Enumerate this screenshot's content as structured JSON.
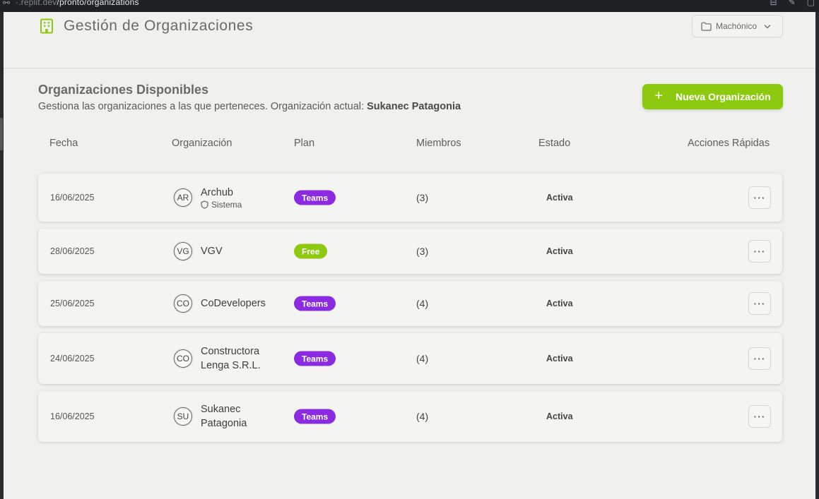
{
  "browser": {
    "url_prefix": "·.replit.dev",
    "url_path": "/pronto/organizations"
  },
  "header": {
    "title": "Gestión de Organizaciones",
    "icon": "building-icon",
    "project_select": "Machónico"
  },
  "section": {
    "title": "Organizaciones Disponibles",
    "subtitle": "Gestiona las organizaciones a las que perteneces. Organización actual: ",
    "current_org": "Sukanec Patagonia",
    "new_button": "Nueva Organización"
  },
  "table": {
    "headers": [
      "Fecha",
      "Organización",
      "Plan",
      "Miembros",
      "Estado",
      "Acciones Rápidas"
    ],
    "rows": [
      {
        "date": "16/06/2025",
        "initials": "AR",
        "name": "Archub",
        "name2": "",
        "tag": "Sistema",
        "plan": "Teams",
        "members": "(3)",
        "status": "Activa"
      },
      {
        "date": "28/06/2025",
        "initials": "VG",
        "name": "VGV",
        "name2": "",
        "tag": "",
        "plan": "Free",
        "members": "(3)",
        "status": "Activa"
      },
      {
        "date": "25/06/2025",
        "initials": "CO",
        "name": "CoDevelopers",
        "name2": "",
        "tag": "",
        "plan": "Teams",
        "members": "(4)",
        "status": "Activa"
      },
      {
        "date": "24/06/2025",
        "initials": "CO",
        "name": "Constructora",
        "name2": "Lenga S.R.L.",
        "tag": "",
        "plan": "Teams",
        "members": "(4)",
        "status": "Activa"
      },
      {
        "date": "16/06/2025",
        "initials": "SU",
        "name": "Sukanec",
        "name2": "Patagonia",
        "tag": "",
        "plan": "Teams",
        "members": "(4)",
        "status": "Activa"
      }
    ],
    "menu_label": "···"
  },
  "colors": {
    "accent_green": "#8dc90f",
    "teams_purple": "#8a2be2",
    "background": "#f0f0ee"
  }
}
